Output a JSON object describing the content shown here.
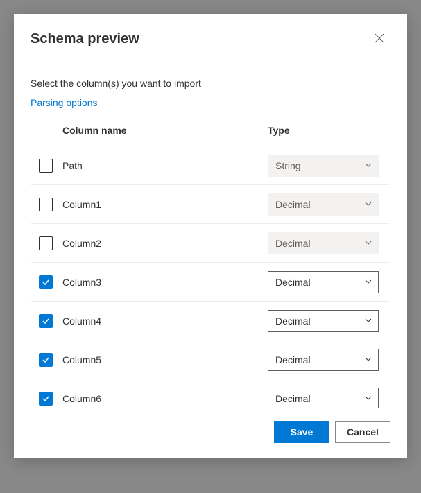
{
  "dialog": {
    "title": "Schema preview",
    "subtitle": "Select the column(s) you want to import",
    "parsing_link": "Parsing options",
    "save_label": "Save",
    "cancel_label": "Cancel"
  },
  "table": {
    "headers": {
      "name": "Column name",
      "type": "Type"
    },
    "rows": [
      {
        "name": "Path",
        "type": "String",
        "checked": false,
        "disabled": true
      },
      {
        "name": "Column1",
        "type": "Decimal",
        "checked": false,
        "disabled": true
      },
      {
        "name": "Column2",
        "type": "Decimal",
        "checked": false,
        "disabled": true
      },
      {
        "name": "Column3",
        "type": "Decimal",
        "checked": true,
        "disabled": false
      },
      {
        "name": "Column4",
        "type": "Decimal",
        "checked": true,
        "disabled": false
      },
      {
        "name": "Column5",
        "type": "Decimal",
        "checked": true,
        "disabled": false
      },
      {
        "name": "Column6",
        "type": "Decimal",
        "checked": true,
        "disabled": false
      }
    ]
  }
}
